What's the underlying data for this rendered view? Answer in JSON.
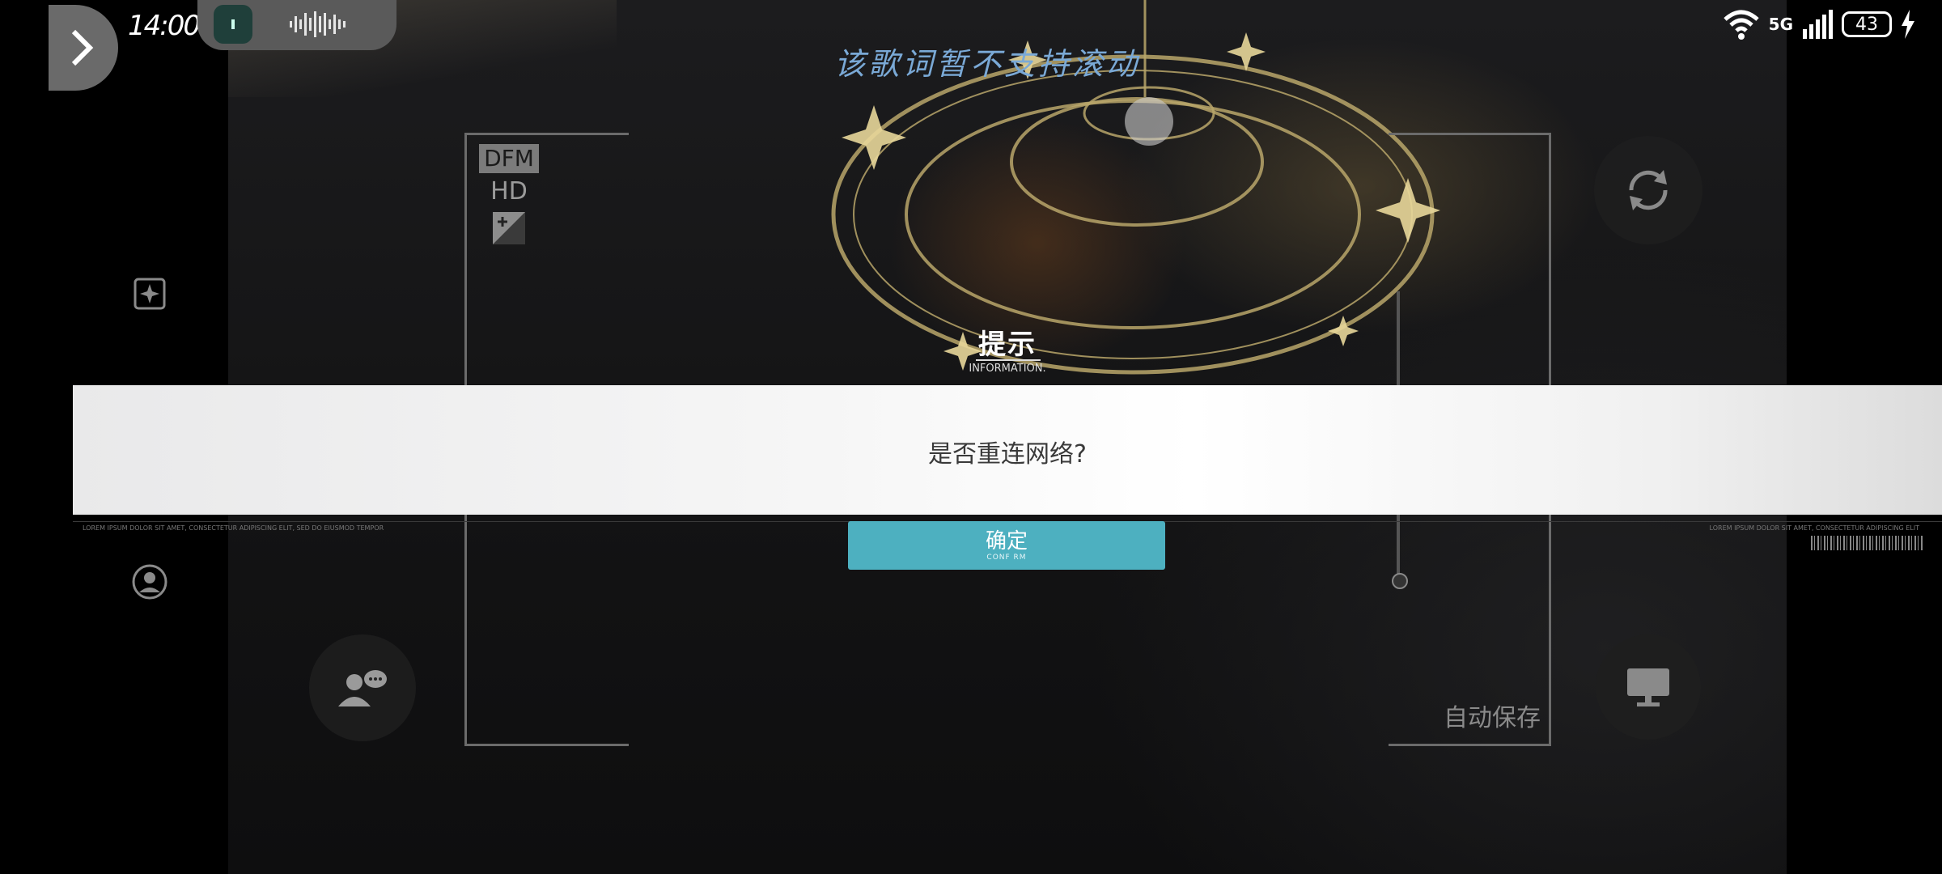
{
  "status_bar": {
    "time": "14:00",
    "network": "5G",
    "battery": "43"
  },
  "lyric": "该歌词暂不支持滚动",
  "hud": {
    "quality_dfm": "DFM",
    "quality_hd": "HD",
    "autosave": "自动保存"
  },
  "dialog": {
    "title": "提示",
    "subtitle": "INFORMATION.",
    "message": "是否重连网络?",
    "confirm_label": "确定",
    "confirm_sub": "CONF RM",
    "footer_left": "LOREM IPSUM DOLOR SIT AMET, CONSECTETUR ADIPISCING ELIT, SED DO EIUSMOD TEMPOR",
    "footer_right": "LOREM IPSUM DOLOR SIT AMET, CONSECTETUR ADIPISCING ELIT"
  },
  "icons": {
    "back": "chevron-right-icon",
    "music_thumb": "music-app-icon",
    "waveform": "waveform-icon",
    "wifi": "wifi-icon",
    "signal": "signal-icon",
    "charging": "bolt-icon",
    "photo_sparkle": "sparkle-photo-icon",
    "profile": "profile-icon",
    "chat": "chat-icon",
    "refresh": "refresh-icon",
    "monitor": "monitor-icon"
  },
  "colors": {
    "confirm_button": "#4db0c0",
    "lyric": "#7aa9d6",
    "dialog_band": "#f4f4f4"
  }
}
